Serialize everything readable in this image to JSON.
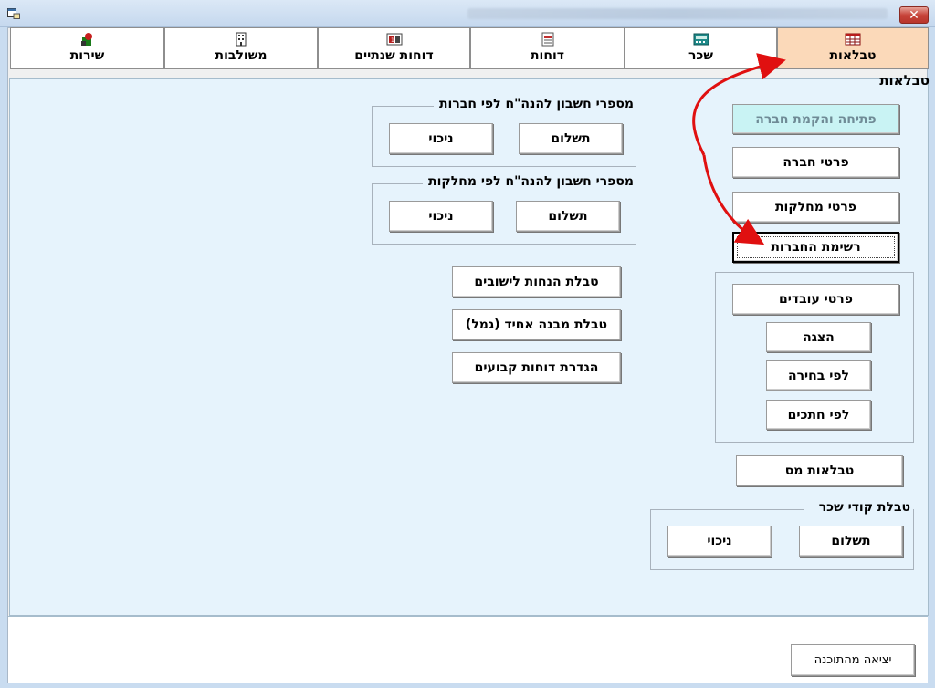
{
  "window": {
    "title": ""
  },
  "tabs": [
    {
      "id": "tables",
      "label": "טבלאות",
      "icon": "table-icon",
      "active": true
    },
    {
      "id": "salary",
      "label": "שכר",
      "icon": "calculator-icon",
      "active": false
    },
    {
      "id": "reports",
      "label": "דוחות",
      "icon": "report-icon",
      "active": false
    },
    {
      "id": "annual",
      "label": "דוחות שנתיים",
      "icon": "calendar-report-icon",
      "active": false
    },
    {
      "id": "combined",
      "label": "משולבות",
      "icon": "building-icon",
      "active": false
    },
    {
      "id": "services",
      "label": "שירות",
      "icon": "service-icon",
      "active": false
    }
  ],
  "panel": {
    "title": "טבלאות",
    "buttons": {
      "open_company": "פתיחה והקמת חברה",
      "company_details": "פרטי חברה",
      "department_details": "פרטי מחלקות",
      "company_list": "רשימת החברות",
      "employee_details": "פרטי עובדים",
      "display": "הצגה",
      "by_selection": "לפי בחירה",
      "by_sections": "לפי חתכים",
      "tax_tables": "טבלאות מס",
      "settlement_discounts": "טבלת הנחות לישובים",
      "uniform_structure": "טבלת מבנה אחיד (גמל)",
      "fixed_reports": "הגדרת דוחות קבועים"
    },
    "groups": {
      "accounts_by_company": {
        "label": "מספרי חשבון להנה\"ח לפי חברות",
        "payment": "תשלום",
        "deduction": "ניכוי"
      },
      "accounts_by_department": {
        "label": "מספרי חשבון להנה\"ח לפי מחלקות",
        "payment": "תשלום",
        "deduction": "ניכוי"
      },
      "salary_codes": {
        "label": "טבלת קודי שכר",
        "payment": "תשלום",
        "deduction": "ניכוי"
      }
    }
  },
  "footer": {
    "exit_label": "יציאה מהתוכנה"
  },
  "colors": {
    "active_tab": "#fbd9b9",
    "panel_bg": "#e6f3fc",
    "arrow": "#e01010",
    "disabled_button": "#c9f3f4"
  }
}
